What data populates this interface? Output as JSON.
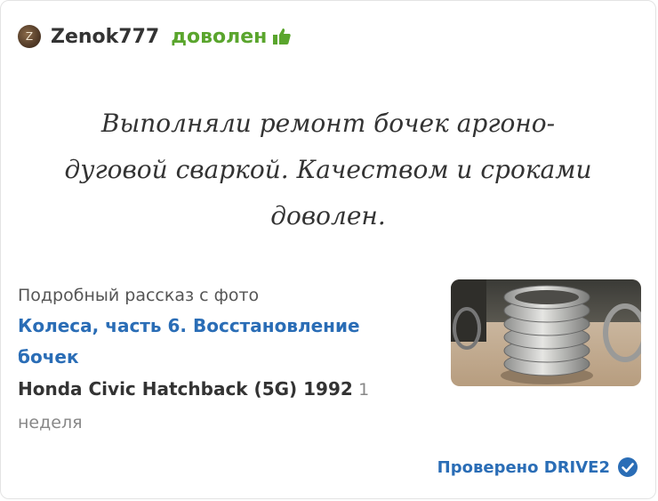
{
  "review": {
    "avatar_letter": "Z",
    "username": "Zenok777",
    "status": "доволен",
    "status_color": "#5aa52d",
    "status_icon": "thumbs-up-icon",
    "quote_lines": [
      "Выполняли ремонт бочек аргоно-",
      "дуговой сваркой. Качеством и сроками",
      "доволен."
    ]
  },
  "story": {
    "caption": "Подробный рассказ с фото",
    "link_text": "Колеса, часть 6. Восстановление бочек",
    "car": "Honda Civic Hatchback (5G) 1992",
    "time": "1 неделя",
    "link_color": "#2a6db6"
  },
  "footer": {
    "verified_label": "Проверено DRIVE2",
    "verified_icon": "check-circle-icon"
  }
}
